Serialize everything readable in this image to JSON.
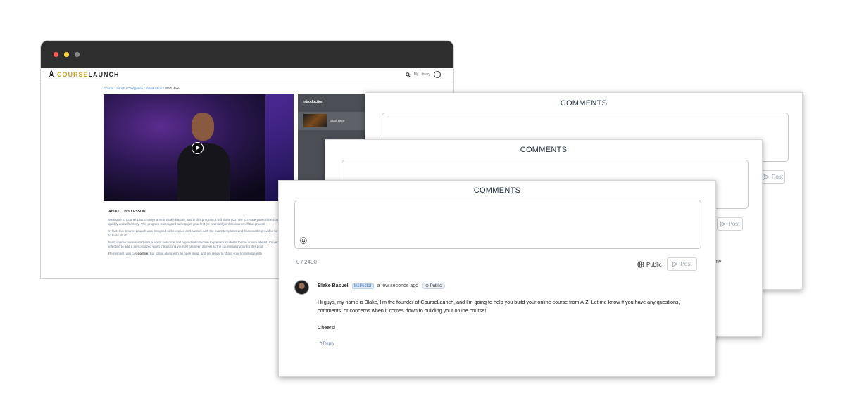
{
  "browser": {
    "logo": {
      "part1": "COURSE",
      "part2": "LAUNCH"
    },
    "header": {
      "library": "My Library"
    },
    "breadcrumb": {
      "path": "Course Launch / Categories / Introduction / ",
      "current": "Start Here"
    },
    "lesson_panel": {
      "title": "Introduction",
      "item": "Start Here"
    },
    "about": {
      "heading": "ABOUT THIS LESSON",
      "p1": "Welcome to Course Launch! My name is Blake Basuel, and in this program, I will show you how to create your online course quickly and effectively. This program is designed to help get your first (or twentieth) online course off the ground.",
      "p2": "In fact, this Course Launch was designed to be copied and pasted, with the exact templates and frameworks provided for you to build off of.",
      "p3": "Most online courses start with a warm welcome and a good introduction to prepare students for the course ahead. It's very effective to add a personalized video introducing yourself (as seen above) as the course instructor for this post.",
      "p4a": "Remember, you can ",
      "p4b": "do this",
      "p4c": ". So, follow along with an open mind, and get ready to share your knowledge with"
    }
  },
  "comments": {
    "title": "COMMENTS",
    "post_label": "Post",
    "counter": "0 / 2400",
    "visibility": "Public",
    "peek_text": "ny",
    "comment": {
      "author": "Blake Basuel",
      "role": "Instructor",
      "time": "a few seconds ago",
      "visibility": "Public",
      "body": "Hi guys, my name is Blake, I'm the founder of CourseLaunch, and I'm going to help you build your online course from A-Z. Let me know if you have any questions, comments, or concerns when it comes down to building your online course!",
      "signoff": "Cheers!",
      "reply": "Reply"
    }
  },
  "colors": {
    "accent": "#2e6db3",
    "logo_gold": "#c9a227",
    "dark_bar": "#2f2f2f"
  },
  "icons": [
    "rocket-icon",
    "search-icon",
    "user-icon",
    "play-icon",
    "send-icon",
    "smiley-icon",
    "globe-icon",
    "reply-icon"
  ]
}
